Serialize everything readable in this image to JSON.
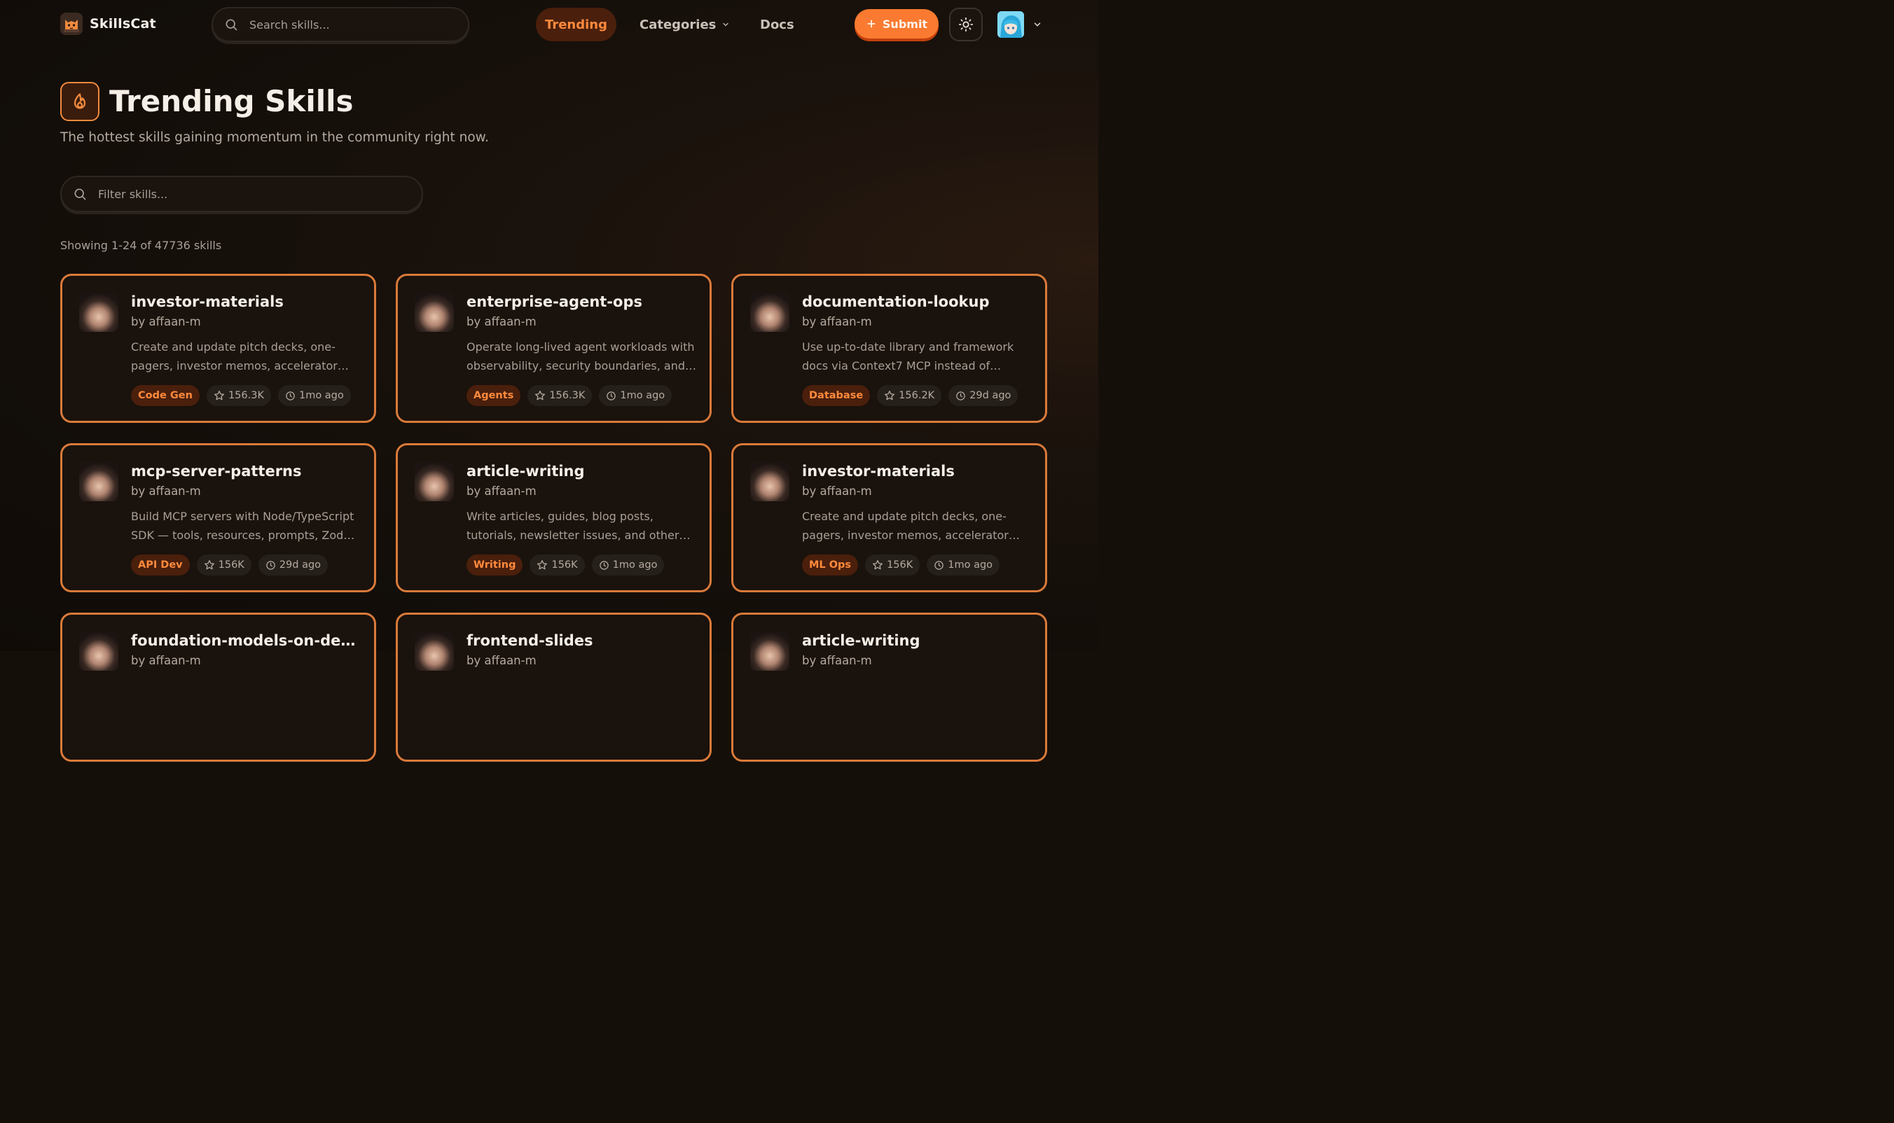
{
  "header": {
    "brand": "SkillsCat",
    "search_placeholder": "Search skills...",
    "nav": {
      "trending": "Trending",
      "categories": "Categories",
      "docs": "Docs"
    },
    "submit_label": "Submit"
  },
  "hero": {
    "title": "Trending Skills",
    "subtitle": "The hottest skills gaining momentum in the community right now.",
    "filter_placeholder": "Filter skills...",
    "showing": "Showing 1-24 of 47736 skills"
  },
  "colors": {
    "accent": "#f97a30",
    "card_border": "#d97a3a",
    "tag_bg": "#4a1f0c",
    "tag_text": "#ff8a3d"
  },
  "cards": [
    {
      "title": "investor-materials",
      "author": "by affaan-m",
      "desc": "Create and update pitch decks, one-pagers, investor memos, accelerator applications, and financial models",
      "tag": "Code Gen",
      "stars": "156.3K",
      "time": "1mo ago"
    },
    {
      "title": "enterprise-agent-ops",
      "author": "by affaan-m",
      "desc": "Operate long-lived agent workloads with observability, security boundaries, and lifecycle management",
      "tag": "Agents",
      "stars": "156.3K",
      "time": "1mo ago"
    },
    {
      "title": "documentation-lookup",
      "author": "by affaan-m",
      "desc": "Use up-to-date library and framework docs via Context7 MCP instead of training data",
      "tag": "Database",
      "stars": "156.2K",
      "time": "29d ago"
    },
    {
      "title": "mcp-server-patterns",
      "author": "by affaan-m",
      "desc": "Build MCP servers with Node/TypeScript SDK — tools, resources, prompts, Zod validation",
      "tag": "API Dev",
      "stars": "156K",
      "time": "29d ago"
    },
    {
      "title": "article-writing",
      "author": "by affaan-m",
      "desc": "Write articles, guides, blog posts, tutorials, newsletter issues, and other long-form content",
      "tag": "Writing",
      "stars": "156K",
      "time": "1mo ago"
    },
    {
      "title": "investor-materials",
      "author": "by affaan-m",
      "desc": "Create and update pitch decks, one-pagers, investor memos, accelerator applications, and financial models",
      "tag": "ML Ops",
      "stars": "156K",
      "time": "1mo ago"
    },
    {
      "title": "foundation-models-on-device",
      "author": "by affaan-m",
      "desc": "",
      "tag": "",
      "stars": "",
      "time": ""
    },
    {
      "title": "frontend-slides",
      "author": "by affaan-m",
      "desc": "",
      "tag": "",
      "stars": "",
      "time": ""
    },
    {
      "title": "article-writing",
      "author": "by affaan-m",
      "desc": "",
      "tag": "",
      "stars": "",
      "time": ""
    }
  ]
}
